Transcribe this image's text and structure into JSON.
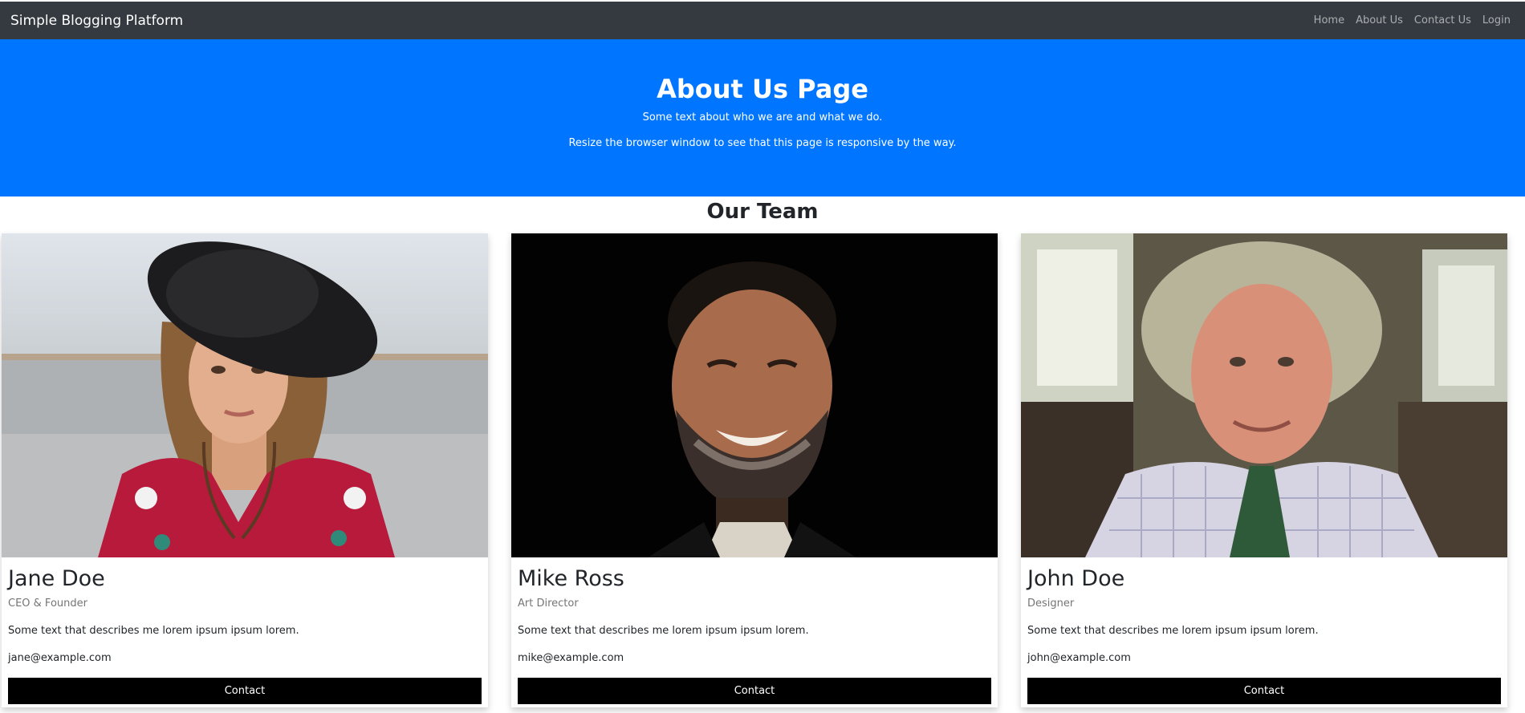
{
  "navbar": {
    "brand": "Simple Blogging Platform",
    "links": [
      "Home",
      "About Us",
      "Contact Us",
      "Login"
    ]
  },
  "hero": {
    "title": "About Us Page",
    "subtitle": "Some text about who we are and what we do.",
    "note": "Resize the browser window to see that this page is responsive by the way."
  },
  "team": {
    "heading": "Our Team",
    "members": [
      {
        "name": "Jane Doe",
        "role": "CEO & Founder",
        "description": "Some text that describes me lorem ipsum ipsum lorem.",
        "email": "jane@example.com",
        "button": "Contact"
      },
      {
        "name": "Mike Ross",
        "role": "Art Director",
        "description": "Some text that describes me lorem ipsum ipsum lorem.",
        "email": "mike@example.com",
        "button": "Contact"
      },
      {
        "name": "John Doe",
        "role": "Designer",
        "description": "Some text that describes me lorem ipsum ipsum lorem.",
        "email": "john@example.com",
        "button": "Contact"
      }
    ]
  },
  "colors": {
    "navbar": "#343a40",
    "hero": "#0075ff",
    "button": "#000000"
  }
}
